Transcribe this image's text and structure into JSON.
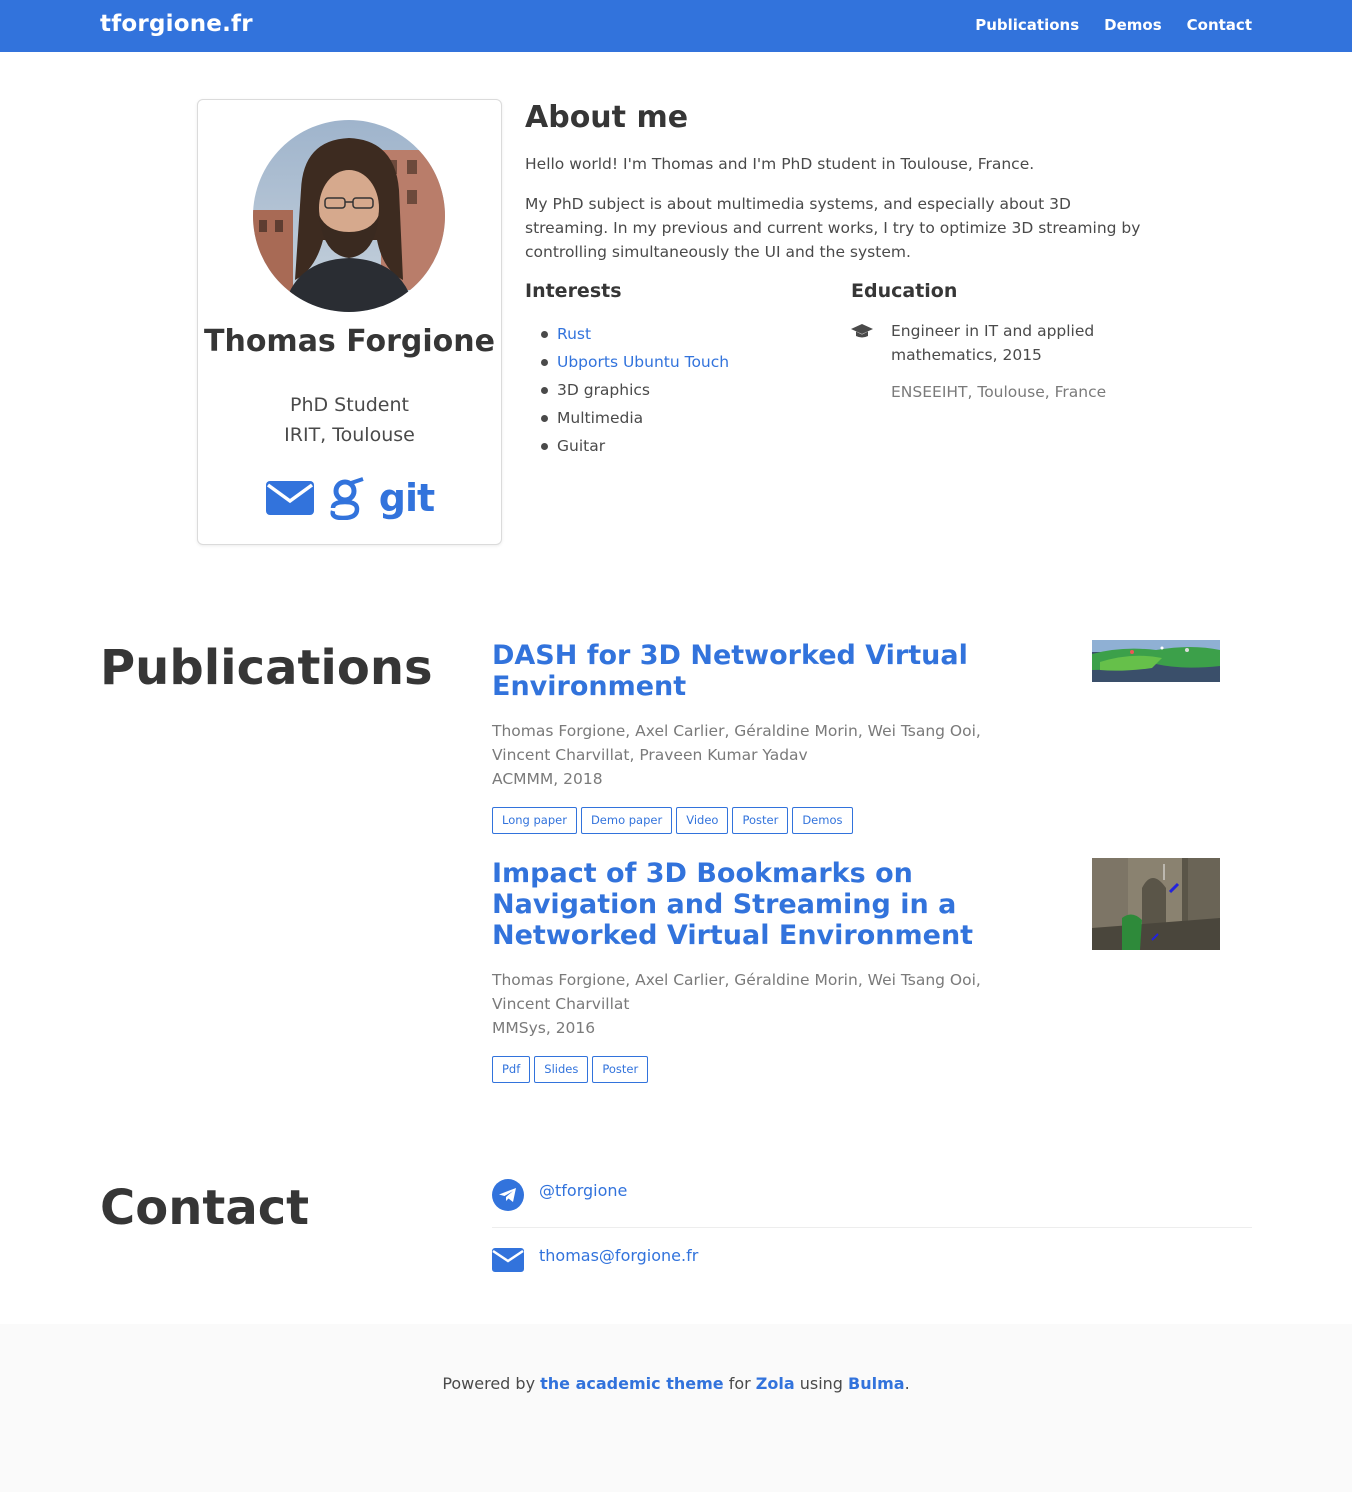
{
  "navbar": {
    "brand": "tforgione.fr",
    "items": [
      {
        "label": "Publications"
      },
      {
        "label": "Demos"
      },
      {
        "label": "Contact"
      }
    ]
  },
  "profile": {
    "name": "Thomas Forgione",
    "role": "PhD Student",
    "institution": "IRIT, Toulouse",
    "links": {
      "git_label": "git"
    }
  },
  "about": {
    "title": "About me",
    "paragraphs": [
      "Hello world! I'm Thomas and I'm PhD student in Toulouse, France.",
      "My PhD subject is about multimedia systems, and especially about 3D streaming. In my previous and current works, I try to optimize 3D streaming by controlling simultaneously the UI and the system."
    ],
    "interests_title": "Interests",
    "interests": [
      {
        "label": "Rust",
        "link": true
      },
      {
        "label": "Ubports Ubuntu Touch",
        "link": true
      },
      {
        "label": "3D graphics",
        "link": false
      },
      {
        "label": "Multimedia",
        "link": false
      },
      {
        "label": "Guitar",
        "link": false
      }
    ],
    "education_title": "Education",
    "education": {
      "degree": "Engineer in IT and applied mathematics, 2015",
      "school": "ENSEEIHT, Toulouse, France"
    }
  },
  "publications": {
    "title": "Publications",
    "items": [
      {
        "title": "DASH for 3D Networked Virtual Environment",
        "authors": "Thomas Forgione, Axel Carlier, Géraldine Morin, Wei Tsang Ooi, Vincent Charvillat, Praveen Kumar Yadav",
        "venue": "ACMMM, 2018",
        "tags": [
          "Long paper",
          "Demo paper",
          "Video",
          "Poster",
          "Demos"
        ]
      },
      {
        "title": "Impact of 3D Bookmarks on Navigation and Streaming in a Networked Virtual Environment",
        "authors": "Thomas Forgione, Axel Carlier, Géraldine Morin, Wei Tsang Ooi, Vincent Charvillat",
        "venue": "MMSys, 2016",
        "tags": [
          "Pdf",
          "Slides",
          "Poster"
        ]
      }
    ]
  },
  "contact": {
    "title": "Contact",
    "telegram": "@tforgione",
    "email": "thomas@forgione.fr"
  },
  "footer": {
    "prefix": "Powered by ",
    "theme_link": "the academic theme",
    "for_text": " for ",
    "zola_link": "Zola",
    "using_text": " using ",
    "bulma_link": "Bulma",
    "suffix": "."
  },
  "colors": {
    "primary": "#3273dc",
    "text": "#4a4a4a",
    "heading": "#363636",
    "muted": "#7a7a7a",
    "footer_bg": "#fafafa"
  }
}
